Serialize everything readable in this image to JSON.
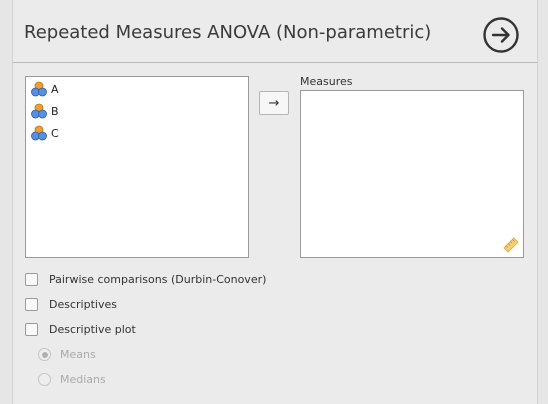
{
  "title": "Repeated Measures ANOVA (Non-parametric)",
  "variables": [
    {
      "label": "A",
      "icon": "continuous-variable-icon"
    },
    {
      "label": "B",
      "icon": "continuous-variable-icon"
    },
    {
      "label": "C",
      "icon": "continuous-variable-icon"
    }
  ],
  "move_button": "→",
  "measures_label": "Measures",
  "options": {
    "pairwise": "Pairwise comparisons (Durbin-Conover)",
    "descriptives": "Descriptives",
    "descriptive_plot": "Descriptive plot",
    "means": "Means",
    "medians": "Medians"
  },
  "states": {
    "pairwise": false,
    "descriptives": false,
    "descriptive_plot": false,
    "means_selected": true,
    "medians_selected": false
  },
  "colors": {
    "accent_dark": "#3a3a3a",
    "variable_icon_orange": "#f0a030",
    "variable_icon_blue": "#3b6fc4",
    "ruler_icon": "#f0c060"
  }
}
